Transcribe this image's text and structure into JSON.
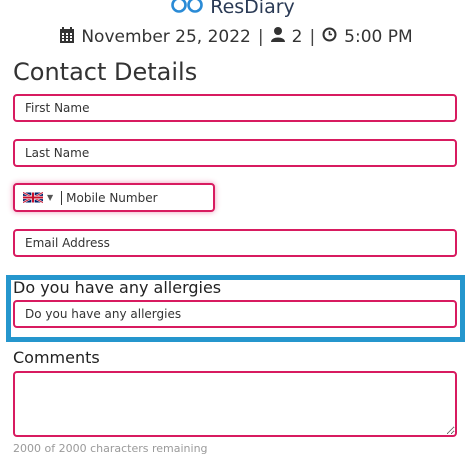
{
  "brand": {
    "name": "ResDiary",
    "tm": "™"
  },
  "booking": {
    "date": "November 25, 2022",
    "covers": "2",
    "time": "5:00 PM",
    "separator": "|"
  },
  "form": {
    "title": "Contact Details",
    "first_name": {
      "placeholder": "First Name",
      "value": ""
    },
    "last_name": {
      "placeholder": "Last Name",
      "value": ""
    },
    "phone": {
      "country": "GB",
      "placeholder": "Mobile Number",
      "value": ""
    },
    "email": {
      "placeholder": "Email Address",
      "value": ""
    },
    "allergies": {
      "label": "Do you have any allergies",
      "placeholder": "Do you have any allergies",
      "value": ""
    },
    "comments": {
      "label": "Comments",
      "value": "",
      "remaining_text": "2000 of 2000 characters remaining"
    }
  },
  "colors": {
    "field_border": "#d81b60",
    "highlight_border": "#2596cd",
    "logo": "#2a8bd6"
  },
  "icons": {
    "date": "calendar-icon",
    "covers": "person-icon",
    "time": "clock-icon",
    "country": "uk-flag-icon",
    "dropdown": "caret-down-icon"
  }
}
